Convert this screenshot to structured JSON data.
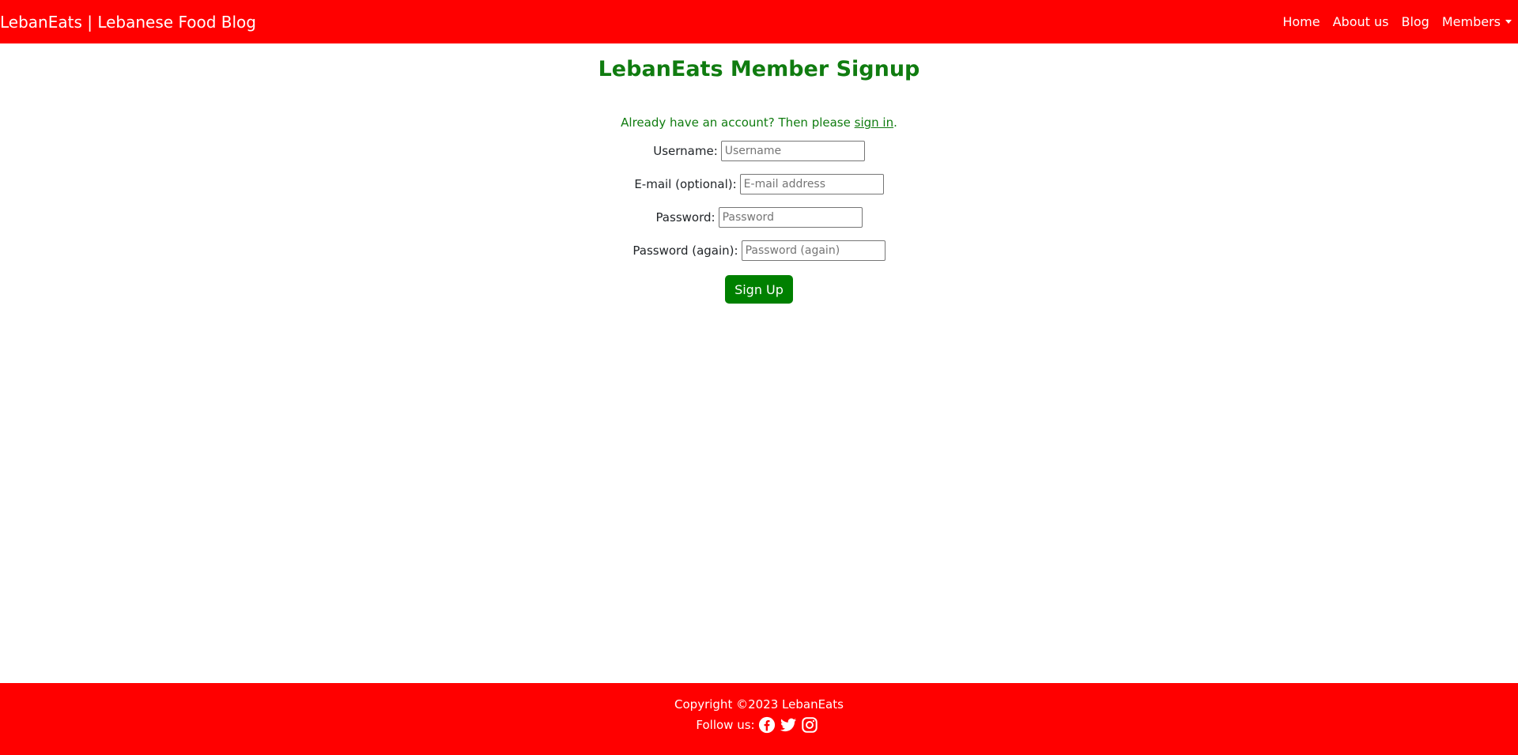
{
  "nav": {
    "brand": "LebanEats | Lebanese Food Blog",
    "links": [
      "Home",
      "About us",
      "Blog",
      "Members"
    ]
  },
  "main": {
    "title": "LebanEats Member Signup",
    "notice_prefix": "Already have an account? Then please ",
    "notice_link": "sign in",
    "notice_suffix": ".",
    "fields": [
      {
        "label": "Username:",
        "placeholder": "Username"
      },
      {
        "label": "E-mail (optional):",
        "placeholder": "E-mail address"
      },
      {
        "label": "Password:",
        "placeholder": "Password"
      },
      {
        "label": "Password (again):",
        "placeholder": "Password (again)"
      }
    ],
    "submit_label": "Sign Up"
  },
  "footer": {
    "copyright": "Copyright ©2023 LebanEats",
    "follow_label": "Follow us:",
    "social_icons": [
      "facebook-icon",
      "twitter-icon",
      "instagram-icon"
    ]
  },
  "colors": {
    "brand_red": "#ff0000",
    "accent_green": "#107c10",
    "button_green": "#008000"
  }
}
